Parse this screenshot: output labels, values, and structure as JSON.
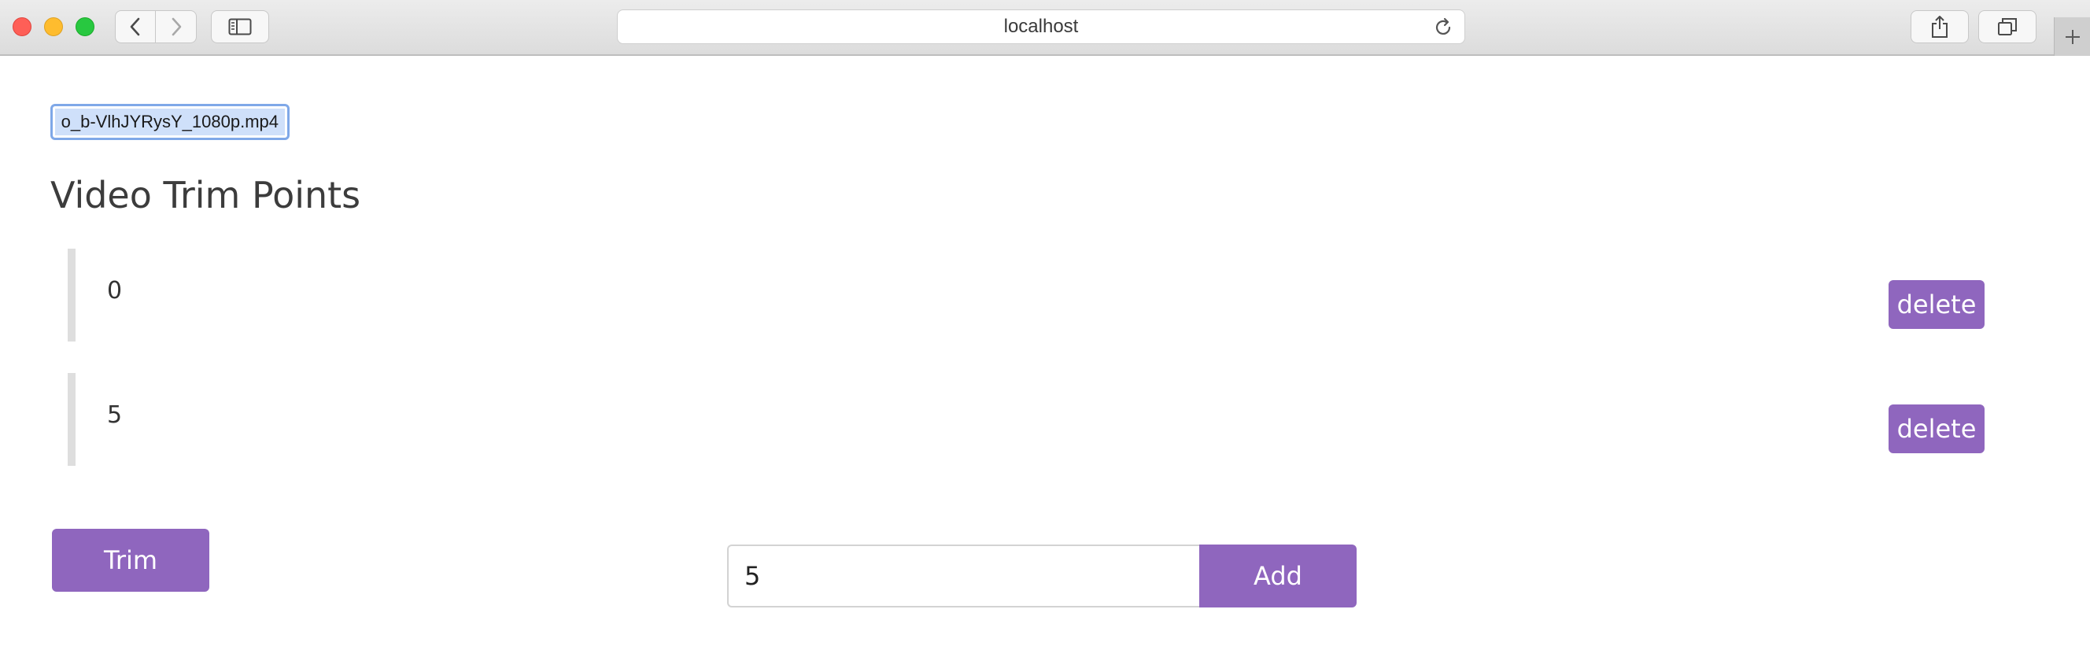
{
  "browser": {
    "address": "localhost",
    "icons": {
      "back": "chevron-left-icon",
      "forward": "chevron-right-icon",
      "sidebar": "sidebar-icon",
      "reload": "reload-icon",
      "share": "share-icon",
      "tabs": "tabs-overview-icon",
      "new_tab": "plus-icon"
    }
  },
  "file_input": {
    "selected_file": "o_b-VlhJYRysY_1080p.mp4"
  },
  "page": {
    "title": "Video Trim Points"
  },
  "trim_points": [
    {
      "value": "0",
      "delete_label": "delete"
    },
    {
      "value": "5",
      "delete_label": "delete"
    }
  ],
  "actions": {
    "trim_label": "Trim",
    "add_input_value": "5",
    "add_label": "Add"
  },
  "colors": {
    "accent": "#8f66be",
    "item_bar": "#dedede",
    "file_selection": "#cfe0fa"
  }
}
